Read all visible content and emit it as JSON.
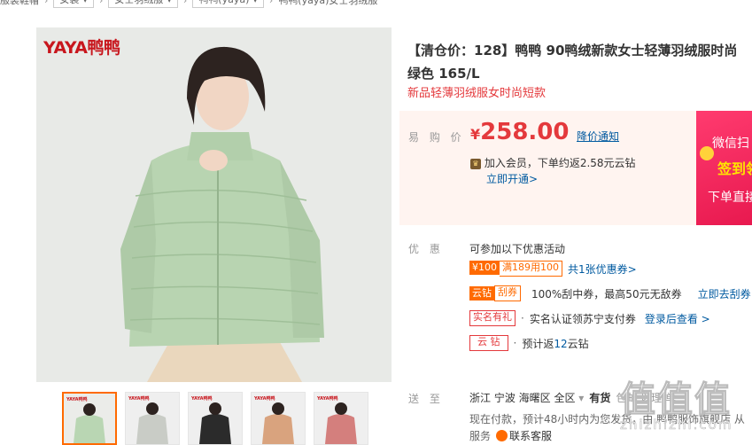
{
  "breadcrumb": {
    "items": [
      "服装鞋帽",
      "女装",
      "女士羽绒服",
      "鸭鸭(yaya)",
      "鸭鸭(yaya)女士羽绒服"
    ]
  },
  "gallery": {
    "brand_logo_text": "YAYA鸭鸭",
    "thumbnail_brand": "YAYA鸭鸭",
    "thumbnail_count": 5,
    "thumbnail_colors": [
      "#b9d6b3",
      "#c9ccc6",
      "#2b2b2b",
      "#d9a37e",
      "#d47f7d"
    ]
  },
  "product": {
    "title_line1": "【清仓价：128】鸭鸭 90鸭绒新款女士轻薄羽绒服时尚",
    "title_line2": "绿色 165/L",
    "subtitle": "新品轻薄羽绒服女时尚短款"
  },
  "price": {
    "label": "易 购 价",
    "currency": "¥",
    "value": "258.00",
    "notify_link": "降价通知",
    "member_text": "加入会员，下单约返2.58元云钻",
    "member_link": "立即开通>"
  },
  "promo_banner": {
    "line1": "微信扫",
    "line2": "签到领",
    "line3": "下单直接"
  },
  "offers": {
    "label": "优 惠",
    "intro": "可参加以下优惠活动",
    "coupon_amount": "¥100",
    "coupon_condition": "满189用100",
    "coupon_link": "共1张优惠券>",
    "yunzuan_tag": "云钻",
    "guaquan_tag": "刮券",
    "guaquan_text": "100%刮中券，最高50元无敌券",
    "guaquan_link": "立即去刮券",
    "realname_tag": "实名有礼",
    "realname_text": "实名认证领苏宁支付券",
    "realname_link": "登录后查看 >",
    "yunzuan2_tag": "云 钻",
    "yunzuan2_text_prefix": "预计返",
    "yunzuan2_value": "12",
    "yunzuan2_text_suffix": "云钻"
  },
  "delivery": {
    "label": "送 至",
    "location": "浙江 宁波 海曙区 全区",
    "stock": "有货",
    "extra": "包邮  以理  单",
    "ship_note": "现在付款，预计48小时内为您发货，由 鸭鸭服饰旗舰店 从",
    "service_label": "服务",
    "service_link": "联系客服"
  },
  "watermark": {
    "line1": "值值值",
    "line2": "zhizhizhi.com"
  },
  "colors": {
    "accent_red": "#e4393c",
    "accent_orange": "#ff6a00",
    "link_blue": "#005aa0"
  }
}
